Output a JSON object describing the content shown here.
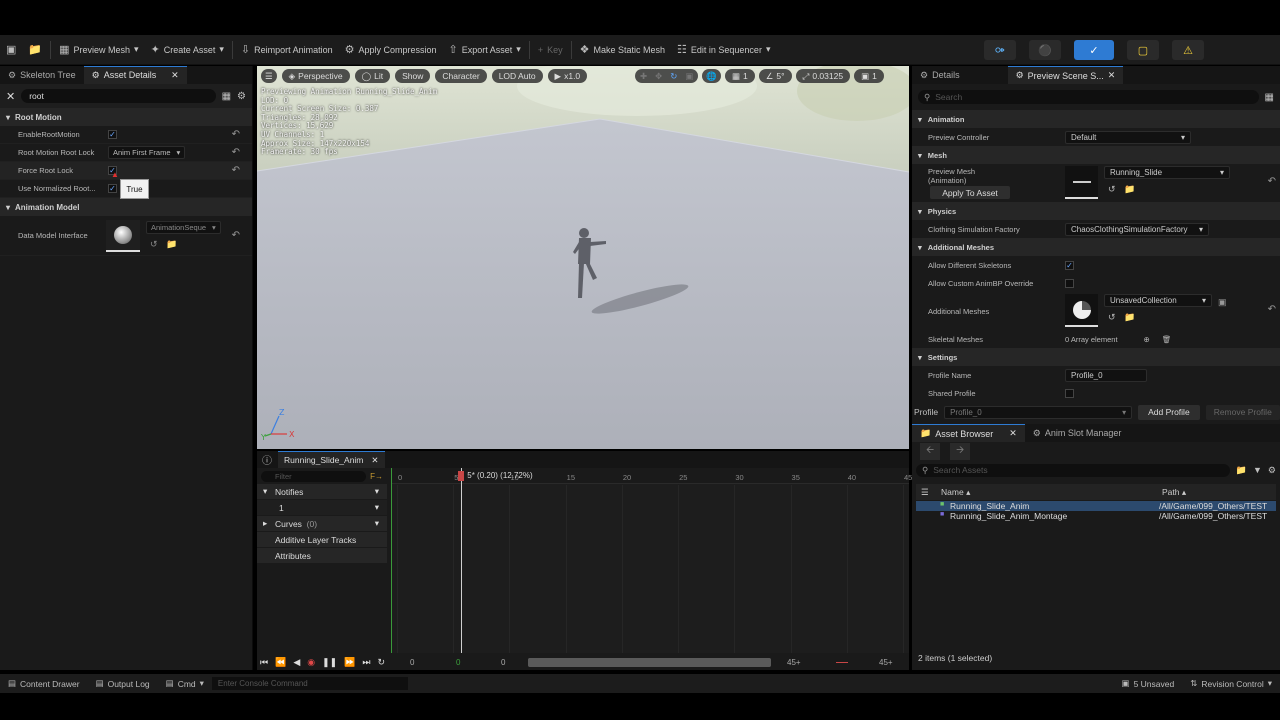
{
  "toolbar": {
    "preview_mesh": "Preview Mesh",
    "create_asset": "Create Asset",
    "reimport_animation": "Reimport Animation",
    "apply_compression": "Apply Compression",
    "export_asset": "Export Asset",
    "key": "Key",
    "make_static_mesh": "Make Static Mesh",
    "edit_in_sequencer": "Edit in Sequencer"
  },
  "left_panel": {
    "tabs": [
      {
        "label": "Skeleton Tree"
      },
      {
        "label": "Asset Details"
      }
    ],
    "search_value": "root",
    "categories": [
      {
        "label": "Root Motion"
      },
      {
        "label": "Animation Model"
      }
    ],
    "rows": {
      "enable_root_motion": "EnableRootMotion",
      "root_motion_root_lock": "Root Motion Root Lock",
      "root_lock_value": "Anim First Frame",
      "force_root_lock": "Force Root Lock",
      "use_normalized_root": "Use Normalized Root...",
      "data_model_interface": "Data Model Interface",
      "data_model_value": "AnimationSeque"
    },
    "tooltip": "True"
  },
  "viewport": {
    "perspective": "Perspective",
    "lit": "Lit",
    "show": "Show",
    "character": "Character",
    "lod": "LOD Auto",
    "play_rate": "x1.0",
    "grid_value": "1",
    "angle_value": "5°",
    "scale_value": "0.03125",
    "cam_value": "1",
    "stats": [
      "Previewing Animation Running_Slide_Anim",
      "LOD: 0",
      "Current Screen Size: 0.387",
      "Triangles: 28,092",
      "Vertices: 15,629",
      "UV Channels: 1",
      "Approx Size: 147x220x154",
      "Framerate: 30 fps"
    ],
    "axis_z": "Z",
    "axis_y": "Y",
    "axis_x": "X"
  },
  "timeline": {
    "tab_label": "Running_Slide_Anim",
    "filter_placeholder": "Filter",
    "tracks": [
      {
        "label": "Notifies"
      },
      {
        "label": "1"
      },
      {
        "label": "Curves"
      },
      {
        "label": "Additive Layer Tracks"
      },
      {
        "label": "Attributes"
      }
    ],
    "curves_count": "(0)",
    "playhead_label": "5* (0.20) (12.72%)",
    "ticks": [
      "0",
      "5",
      "10",
      "15",
      "20",
      "25",
      "30",
      "35",
      "40",
      "45"
    ],
    "bottom_start": "0",
    "bottom_green": "0",
    "bottom_mid": "0",
    "bottom_end_a": "45+",
    "bottom_end_b": "45+",
    "playhead_fraction": 0.127
  },
  "details": {
    "tabs": [
      {
        "label": "Details"
      },
      {
        "label": "Preview Scene S..."
      }
    ],
    "search_placeholder": "Search",
    "cats": {
      "animation": "Animation",
      "mesh": "Mesh",
      "physics": "Physics",
      "additional_meshes": "Additional Meshes",
      "settings": "Settings"
    },
    "rows": {
      "preview_controller": "Preview Controller",
      "preview_controller_value": "Default",
      "preview_mesh_label": "Preview Mesh",
      "preview_mesh_sub": "(Animation)",
      "preview_mesh_value": "Running_Slide",
      "apply_to_asset": "Apply To Asset",
      "clothing_sim": "Clothing Simulation Factory",
      "clothing_sim_value": "ChaosClothingSimulationFactory",
      "allow_diff_skel": "Allow Different Skeletons",
      "allow_custom_animbp": "Allow Custom AnimBP Override",
      "additional_meshes": "Additional Meshes",
      "additional_meshes_value": "UnsavedCollection",
      "skeletal_meshes": "Skeletal Meshes",
      "skeletal_meshes_value": "0 Array element",
      "profile_name": "Profile Name",
      "profile_name_value": "Profile_0",
      "shared_profile": "Shared Profile"
    },
    "profile_label": "Profile",
    "profile_value": "Profile_0",
    "add_profile": "Add Profile",
    "remove_profile": "Remove Profile"
  },
  "asset_browser": {
    "tabs": [
      {
        "label": "Asset Browser"
      },
      {
        "label": "Anim Slot Manager"
      }
    ],
    "search_placeholder": "Search Assets",
    "col_name": "Name",
    "col_path": "Path",
    "rows": [
      {
        "name": "Running_Slide_Anim",
        "path": "/All/Game/099_Others/TEST"
      },
      {
        "name": "Running_Slide_Anim_Montage",
        "path": "/All/Game/099_Others/TEST"
      }
    ],
    "footer": "2 items (1 selected)"
  },
  "statusbar": {
    "content_drawer": "Content Drawer",
    "output_log": "Output Log",
    "cmd": "Cmd",
    "console_placeholder": "Enter Console Command",
    "unsaved": "5 Unsaved",
    "revision_control": "Revision Control"
  },
  "colors": {
    "accent": "#2e7bd3",
    "selection": "#2c4a6e",
    "panel_bg": "#1a1a1a",
    "viewport_floor": "#babdc6",
    "playhead": "#d94a4a"
  }
}
